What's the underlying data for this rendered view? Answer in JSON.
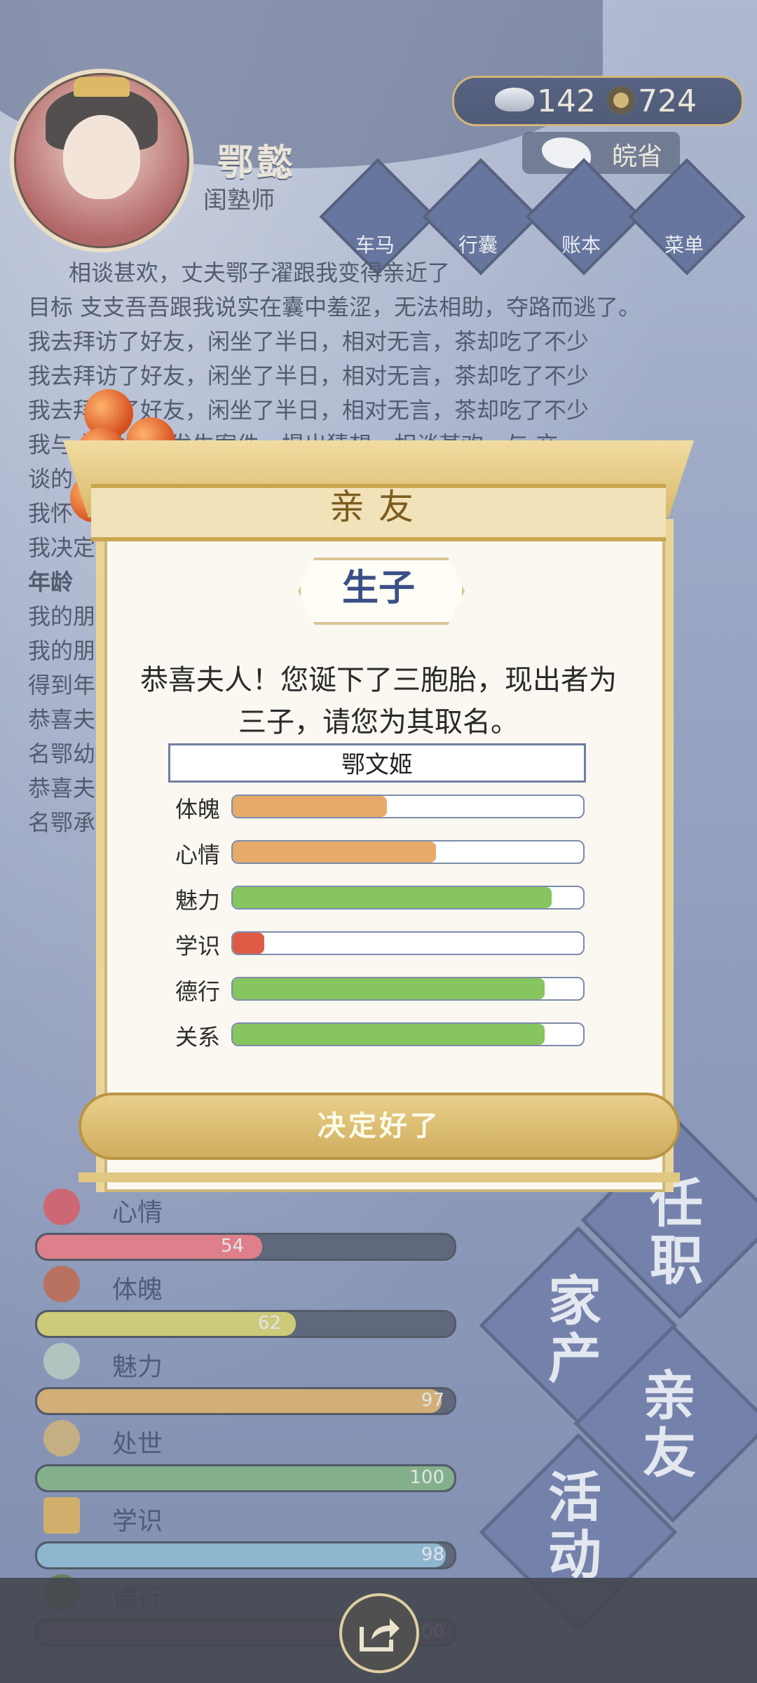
{
  "player": {
    "name": "鄂懿",
    "role": "闺塾师"
  },
  "currency": {
    "silver": "142",
    "coins": "724"
  },
  "location": {
    "label": "皖省"
  },
  "menu": [
    {
      "label": "车马",
      "icon": "carriage-icon"
    },
    {
      "label": "行囊",
      "icon": "bag-icon"
    },
    {
      "label": "账本",
      "icon": "ledger-icon"
    },
    {
      "label": "菜单",
      "icon": "more-icon"
    }
  ],
  "log": [
    "相谈甚欢，丈夫鄂子濯跟我变得亲近了",
    "目标 支支吾吾跟我说实在囊中羞涩，无法相助，夺路而逃了。",
    "我去拜访了好友，闲坐了半日，相对无言，茶却吃了不少",
    "我去拜访了好友，闲坐了半日，相对无言，茶却吃了不少",
    "我去拜访了好友，闲坐了半日，相对无言，茶却吃了不少",
    "我与                探讨近期发生案件，提出猜想，相谈甚欢。与  交",
    "谈的",
    "我怀",
    "我决定",
    "",
    "年龄",
    "我的朋",
    "我的朋",
    "得到年",
    "恭喜夫                                                                  子取",
    "名鄂幼",
    "恭喜夫                                                                  子取",
    "名鄂承"
  ],
  "stats": [
    {
      "label": "心情",
      "value": 54,
      "color": "#d85a6a",
      "icon": "flower-icon"
    },
    {
      "label": "体魄",
      "value": 62,
      "color": "#bfbf52",
      "icon": "drum-icon"
    },
    {
      "label": "魅力",
      "value": 97,
      "color": "#c99a4f",
      "icon": "jade-icon"
    },
    {
      "label": "处世",
      "value": 100,
      "color": "#5f9b68",
      "icon": "shoe-icon"
    },
    {
      "label": "学识",
      "value": 98,
      "color": "#6ea3c5",
      "icon": "books-icon"
    },
    {
      "label": "德行",
      "value": 100,
      "color": "#7d4f90",
      "icon": "plate-icon"
    }
  ],
  "side_menu": [
    {
      "label": "任职"
    },
    {
      "label": "家产"
    },
    {
      "label": "亲友"
    },
    {
      "label": "活动"
    }
  ],
  "dialog": {
    "title": "亲友",
    "subtitle": "生子",
    "message": "恭喜夫人！您诞下了三胞胎，现出者为三子，请您为其取名。",
    "name_value": "鄂文姬",
    "attributes": [
      {
        "label": "体魄",
        "value": 0.44,
        "color": "#e8aa6a"
      },
      {
        "label": "心情",
        "value": 0.58,
        "color": "#e8aa6a"
      },
      {
        "label": "魅力",
        "value": 0.91,
        "color": "#86c55f"
      },
      {
        "label": "学识",
        "value": 0.09,
        "color": "#dd5b45"
      },
      {
        "label": "德行",
        "value": 0.89,
        "color": "#86c55f"
      },
      {
        "label": "关系",
        "value": 0.89,
        "color": "#86c55f"
      }
    ],
    "confirm_label": "决定好了"
  }
}
